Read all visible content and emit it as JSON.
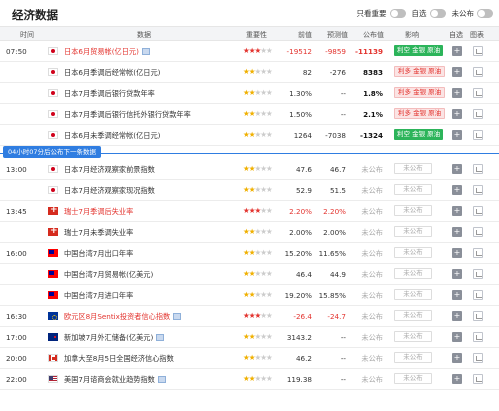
{
  "header": {
    "title": "经济数据",
    "toggles": [
      {
        "label": "只看重要",
        "on": false
      },
      {
        "label": "自选",
        "on": false
      },
      {
        "label": "未公布",
        "on": false
      }
    ]
  },
  "columns": {
    "time": "时间",
    "data": "数据",
    "importance": "重要性",
    "previous": "前值",
    "forecast": "预测值",
    "actual": "公布值",
    "effect": "影响",
    "watch": "自选",
    "chart": "图表"
  },
  "divider": {
    "label": "04小时07分后公布下一条数据"
  },
  "rows_a": [
    {
      "time": "07:50",
      "flag": "jp",
      "name": "日本6月贸易帐(亿日元)",
      "red": true,
      "video": true,
      "stars": 3,
      "previous": "-19512",
      "forecast": "-9859",
      "actual": "-11139",
      "effect": "利空 金银 原油",
      "effect_type": "green",
      "prev_neg": true,
      "fore_neg": true,
      "act_style": "neg"
    },
    {
      "time": "",
      "flag": "jp",
      "name": "日本6月季调后经常帐(亿日元)",
      "red": false,
      "video": false,
      "stars": 2,
      "previous": "82",
      "forecast": "-276",
      "actual": "8383",
      "effect": "利多 金银 原油",
      "effect_type": "red",
      "act_style": "bold"
    },
    {
      "time": "",
      "flag": "jp",
      "name": "日本7月季调后银行贷款年率",
      "red": false,
      "video": false,
      "stars": 2,
      "previous": "1.30%",
      "forecast": "--",
      "actual": "1.8%",
      "effect": "利多 金银 原油",
      "effect_type": "red",
      "act_style": "bold"
    },
    {
      "time": "",
      "flag": "jp",
      "name": "日本7月季调后银行信托外银行贷款年率",
      "red": false,
      "video": false,
      "stars": 2,
      "previous": "1.50%",
      "forecast": "--",
      "actual": "2.1%",
      "effect": "利多 金银 原油",
      "effect_type": "red",
      "act_style": "bold"
    },
    {
      "time": "",
      "flag": "jp",
      "name": "日本6月未季调经常帐(亿日元)",
      "red": false,
      "video": false,
      "stars": 2,
      "previous": "1264",
      "forecast": "-7038",
      "actual": "-1324",
      "effect": "利空 金银 原油",
      "effect_type": "green",
      "act_style": "bold"
    }
  ],
  "rows_b": [
    {
      "time": "13:00",
      "flag": "jp",
      "name": "日本7月经济观察家前景指数",
      "red": false,
      "video": false,
      "stars": 2,
      "previous": "47.6",
      "forecast": "46.7",
      "actual": "未公布",
      "effect": "未公布",
      "effect_type": "none",
      "act_style": "pend"
    },
    {
      "time": "",
      "flag": "jp",
      "name": "日本7月经济观察家现况指数",
      "red": false,
      "video": false,
      "stars": 2,
      "previous": "52.9",
      "forecast": "51.5",
      "actual": "未公布",
      "effect": "未公布",
      "effect_type": "none",
      "act_style": "pend"
    },
    {
      "time": "13:45",
      "flag": "ch",
      "name": "瑞士7月季调后失业率",
      "red": true,
      "video": false,
      "stars": 3,
      "previous": "2.20%",
      "forecast": "2.20%",
      "actual": "未公布",
      "effect": "未公布",
      "effect_type": "none",
      "act_style": "pend",
      "prev_neg": true,
      "fore_neg": true
    },
    {
      "time": "",
      "flag": "ch",
      "name": "瑞士7月未季调失业率",
      "red": false,
      "video": false,
      "stars": 2,
      "previous": "2.00%",
      "forecast": "2.00%",
      "actual": "未公布",
      "effect": "未公布",
      "effect_type": "none",
      "act_style": "pend"
    },
    {
      "time": "16:00",
      "flag": "tw",
      "name": "中国台湾7月出口年率",
      "red": false,
      "video": false,
      "stars": 2,
      "previous": "15.20%",
      "forecast": "11.65%",
      "actual": "未公布",
      "effect": "未公布",
      "effect_type": "none",
      "act_style": "pend"
    },
    {
      "time": "",
      "flag": "tw",
      "name": "中国台湾7月贸易帐(亿美元)",
      "red": false,
      "video": false,
      "stars": 2,
      "previous": "46.4",
      "forecast": "44.9",
      "actual": "未公布",
      "effect": "未公布",
      "effect_type": "none",
      "act_style": "pend"
    },
    {
      "time": "",
      "flag": "tw",
      "name": "中国台湾7月进口年率",
      "red": false,
      "video": false,
      "stars": 2,
      "previous": "19.20%",
      "forecast": "15.85%",
      "actual": "未公布",
      "effect": "未公布",
      "effect_type": "none",
      "act_style": "pend"
    },
    {
      "time": "16:30",
      "flag": "eu",
      "name": "欧元区8月Sentix投资者信心指数",
      "red": true,
      "video": true,
      "stars": 3,
      "previous": "-26.4",
      "forecast": "-24.7",
      "actual": "未公布",
      "effect": "未公布",
      "effect_type": "none",
      "act_style": "pend",
      "prev_neg": true,
      "fore_neg": true
    },
    {
      "time": "17:00",
      "flag": "nz",
      "name": "新加坡7月外汇储备(亿美元)",
      "red": false,
      "video": true,
      "stars": 2,
      "previous": "3143.2",
      "forecast": "--",
      "actual": "未公布",
      "effect": "未公布",
      "effect_type": "none",
      "act_style": "pend"
    },
    {
      "time": "20:00",
      "flag": "ca",
      "name": "加拿大至8月5日全国经济信心指数",
      "red": false,
      "video": false,
      "stars": 2,
      "previous": "46.2",
      "forecast": "--",
      "actual": "未公布",
      "effect": "未公布",
      "effect_type": "none",
      "act_style": "pend"
    },
    {
      "time": "22:00",
      "flag": "us",
      "name": "美国7月谘商会就业趋势指数",
      "red": false,
      "video": true,
      "stars": 2,
      "previous": "119.38",
      "forecast": "--",
      "actual": "未公布",
      "effect": "未公布",
      "effect_type": "none",
      "act_style": "pend"
    }
  ],
  "icons": {
    "add": "plus-icon",
    "chart": "chart-icon",
    "video": "video-icon"
  }
}
